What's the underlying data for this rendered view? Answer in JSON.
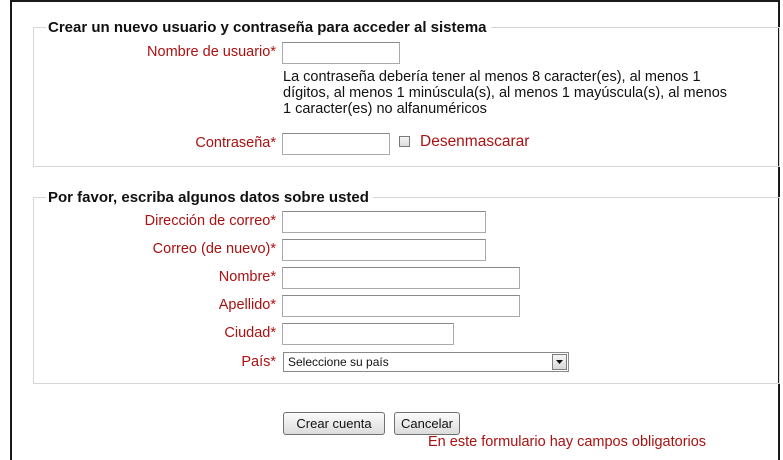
{
  "account_section": {
    "legend": "Crear un nuevo usuario y contraseña para acceder al sistema",
    "username_label": "Nombre de usuario*",
    "username_value": "",
    "password_help": "La contraseña debería tener al menos 8 caracter(es), al menos 1 dígitos, al menos 1 minúscula(s), al menos 1 mayúscula(s), al menos 1 caracter(es) no alfanuméricos",
    "password_label": "Contraseña*",
    "password_value": "",
    "unmask_label": "Desenmascarar",
    "unmask_checked": false
  },
  "details_section": {
    "legend": "Por favor, escriba algunos datos sobre usted",
    "email_label": "Dirección de correo*",
    "email_again_label": "Correo (de nuevo)*",
    "firstname_label": "Nombre*",
    "lastname_label": "Apellido*",
    "city_label": "Ciudad*",
    "country_label": "País*",
    "country_selected": "Seleccione su país"
  },
  "actions": {
    "create_label": "Crear cuenta",
    "cancel_label": "Cancelar"
  },
  "required_note": "En este formulario hay campos obligatorios",
  "colors": {
    "label_red": "#aa1111",
    "text": "#111111",
    "fieldset_border": "#d6d6d6"
  }
}
